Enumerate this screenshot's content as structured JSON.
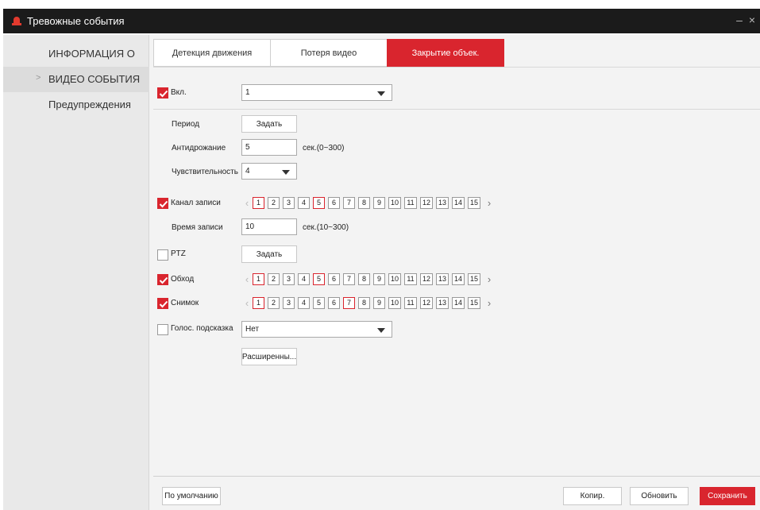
{
  "window": {
    "title": "Тревожные события",
    "controls": "– ×"
  },
  "sidebar": {
    "items": [
      {
        "label": "ИНФОРМАЦИЯ О"
      },
      {
        "label": "ВИДЕО СОБЫТИЯ",
        "active": true,
        "chevron": ">"
      },
      {
        "label": "Предупреждения"
      }
    ]
  },
  "tabs": [
    {
      "label": "Детекция движения"
    },
    {
      "label": "Потеря видео"
    },
    {
      "label": "Закрытие объек.",
      "active": true
    }
  ],
  "enable": {
    "label": "Вкл.",
    "checked": true,
    "channel_value": "1"
  },
  "period": {
    "label": "Период",
    "button": "Задать"
  },
  "antijitter": {
    "label": "Антидрожание",
    "value": "5",
    "hint": "сек.(0~300)"
  },
  "sensitivity": {
    "label": "Чувствительность",
    "value": "4"
  },
  "record_channel": {
    "label": "Канал записи",
    "checked": true,
    "channels": [
      "1",
      "2",
      "3",
      "4",
      "5",
      "6",
      "7",
      "8",
      "9",
      "10",
      "11",
      "12",
      "13",
      "14",
      "15"
    ],
    "selected": [
      "1",
      "5"
    ]
  },
  "record_time": {
    "label": "Время записи",
    "value": "10",
    "hint": "сек.(10~300)"
  },
  "ptz": {
    "label": "PTZ",
    "checked": false,
    "button": "Задать"
  },
  "tour": {
    "label": "Обход",
    "checked": true,
    "channels": [
      "1",
      "2",
      "3",
      "4",
      "5",
      "6",
      "7",
      "8",
      "9",
      "10",
      "11",
      "12",
      "13",
      "14",
      "15"
    ],
    "selected": [
      "1",
      "5"
    ]
  },
  "snapshot": {
    "label": "Снимок",
    "checked": true,
    "channels": [
      "1",
      "2",
      "3",
      "4",
      "5",
      "6",
      "7",
      "8",
      "9",
      "10",
      "11",
      "12",
      "13",
      "14",
      "15"
    ],
    "selected": [
      "1",
      "7"
    ]
  },
  "voice": {
    "label": "Голос. подсказка",
    "checked": false,
    "value": "Нет"
  },
  "advanced": {
    "button": "Расширенны..."
  },
  "footer": {
    "default": "По умолчанию",
    "copy": "Копир.",
    "refresh": "Обновить",
    "save": "Сохранить"
  },
  "colors": {
    "accent": "#d9252e",
    "titlebar": "#1b1b1b",
    "sidebar": "#e9e9e9",
    "panel": "#f3f3f3"
  }
}
